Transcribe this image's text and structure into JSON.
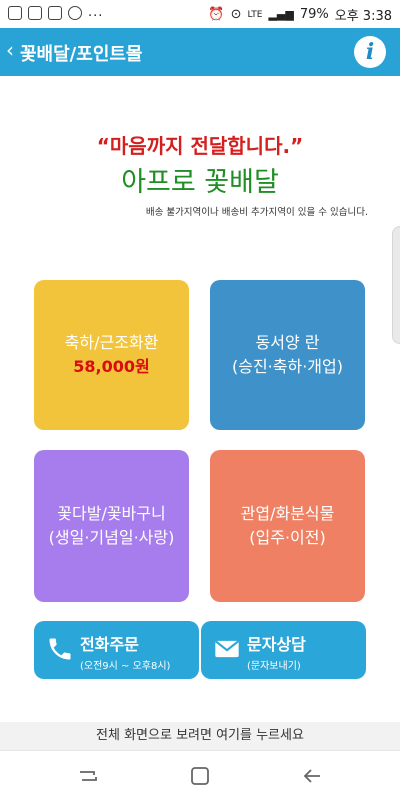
{
  "status": {
    "carrier": "LTE",
    "battery": "79%",
    "time": "오후 3:38",
    "dots": "..."
  },
  "appbar": {
    "title": "꽃배달/포인트몰",
    "info_glyph": "i"
  },
  "headline": "“마음까지 전달합니다.”",
  "brand": "아프로 꽃배달",
  "notice": "배송 불가지역이나 배송비 추가지역이 있을 수 있습니다.",
  "tiles": [
    {
      "line1": "축하/근조화환",
      "price": "58,000원",
      "color": "#f2c43c"
    },
    {
      "line1": "동서양 란",
      "line2": "(승진·축하·개업)",
      "color": "#3f92c9"
    },
    {
      "line1": "꽃다발/꽃바구니",
      "line2": "(생일·기념일·사랑)",
      "color": "#a77ded"
    },
    {
      "line1": "관엽/화분식물",
      "line2": "(입주·이전)",
      "color": "#f08063"
    }
  ],
  "buttons": {
    "call": {
      "label": "전화주문",
      "sub": "(오전9시 ~ 오후8시)",
      "icon": "phone-icon"
    },
    "msg": {
      "label": "문자상담",
      "sub": "(문자보내기)",
      "icon": "envelope-icon"
    }
  },
  "bottom_text": "전체 화면으로 보려면 여기를 누르세요"
}
